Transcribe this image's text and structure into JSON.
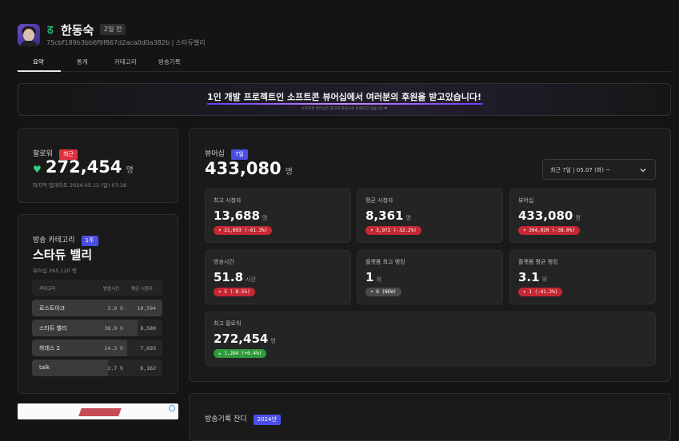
{
  "header": {
    "streamer_name": "한동숙",
    "streamer_icon": "chzzk-icon",
    "time_badge": "2일 전",
    "channel_info": "75cbf189b3bb6f9f867d2aca0d0a382b | 스타듀밸리"
  },
  "tabs": [
    {
      "label": "요약",
      "active": true
    },
    {
      "label": "통계",
      "active": false
    },
    {
      "label": "카테고리",
      "active": false
    },
    {
      "label": "방송기록",
      "active": false
    }
  ],
  "banner": {
    "title": "1인 개발 프로젝트인 소프트콘 뷰어십에서 여러분의 후원을 받고있습니다!",
    "subtitle": "소프트콘 뷰어십은 광고와 후원으로 운영되고 있습니다 ❤"
  },
  "followers": {
    "label": "팔로워",
    "badge": "최근",
    "value": "272,454",
    "unit": "명",
    "updated": "마지막 업데이트 2024.05.12 (일) 07:18"
  },
  "category": {
    "label": "방송 카테고리",
    "badge": "1주",
    "current": "스타듀 밸리",
    "viewers": "뷰어십 265,120 명",
    "columns": [
      "카테고리",
      "방송시간",
      "평균 시청자"
    ],
    "rows": [
      {
        "name": "로스트아크",
        "hours": "3.9 h",
        "viewers": "10,594",
        "share": 1.0
      },
      {
        "name": "스타듀 밸리",
        "hours": "38.9 h",
        "viewers": "8,580",
        "share": 0.81
      },
      {
        "name": "하데스 2",
        "hours": "14.3 h",
        "viewers": "7,693",
        "share": 0.73
      },
      {
        "name": "talk",
        "hours": "2.7 h",
        "viewers": "6,162",
        "share": 0.58
      }
    ]
  },
  "viewership": {
    "label": "뷰어십",
    "badge": "7일",
    "value": "433,080",
    "unit": "명",
    "range": "최근 7일 | 05.07 (화) ~"
  },
  "stats": [
    {
      "label": "최고 시청자",
      "value": "13,688",
      "unit": "명",
      "delta": "▾ 21,693 (-61.3%)",
      "tone": "red"
    },
    {
      "label": "평균 시청자",
      "value": "8,361",
      "unit": "명",
      "delta": "▾ 3,972 (-32.2%)",
      "tone": "red"
    },
    {
      "label": "뷰어십",
      "value": "433,080",
      "unit": "명",
      "delta": "▾ 264,920 (-38.0%)",
      "tone": "red"
    },
    {
      "label": "방송시간",
      "value": "51.8",
      "unit": "시간",
      "delta": "▾ 5 (-8.5%)",
      "tone": "red"
    },
    {
      "label": "플랫폼 최고 랭킹",
      "value": "1",
      "unit": "위",
      "delta": "• 0 (NEW)",
      "tone": "grey"
    },
    {
      "label": "플랫폼 평균 랭킹",
      "value": "3.1",
      "unit": "위",
      "delta": "▾ 1 (-41.2%)",
      "tone": "red"
    },
    {
      "label": "최고 팔로워",
      "value": "272,454",
      "unit": "명",
      "delta": "▴ 1,284 (+0.4%)",
      "tone": "green"
    }
  ],
  "history": {
    "label": "방송기록 잔디",
    "badge": "2024년"
  },
  "colors": {
    "background": "#141414",
    "card": "#1a1a1a",
    "accent_red": "#e0303e",
    "accent_blue": "#4b4fe6",
    "accent_green": "#2fd07e"
  }
}
